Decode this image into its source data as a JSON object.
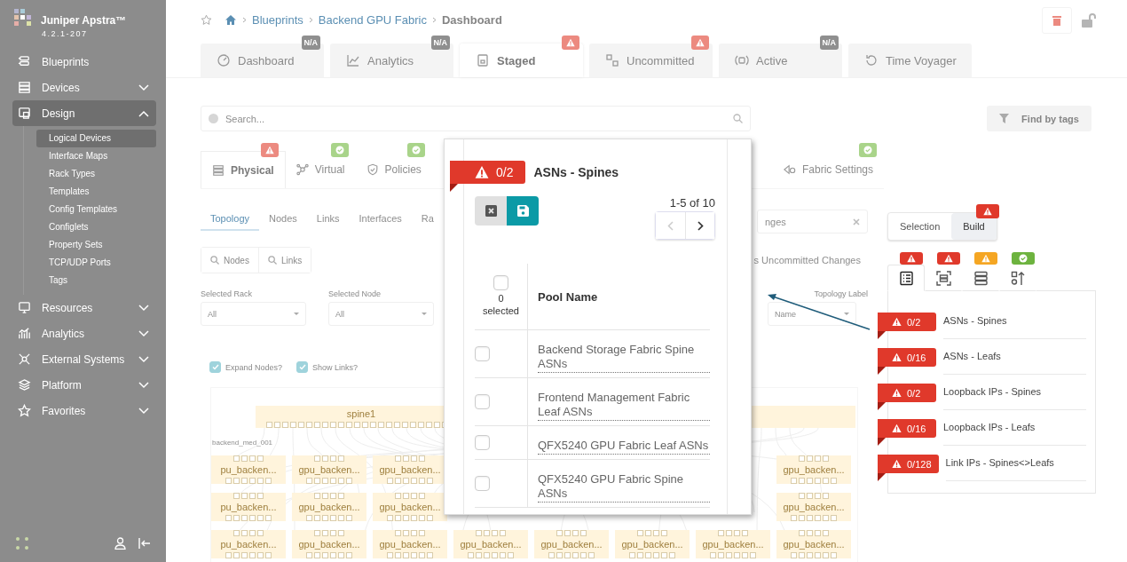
{
  "sidebar": {
    "product": "Juniper Apstra™",
    "version": "4.2.1-207",
    "items": [
      {
        "label": "Blueprints",
        "kind": "link"
      },
      {
        "label": "Devices",
        "kind": "group",
        "expanded": false
      },
      {
        "label": "Design",
        "kind": "group",
        "expanded": true,
        "children": [
          {
            "label": "Logical Devices",
            "selected": true
          },
          {
            "label": "Interface Maps",
            "selected": false
          },
          {
            "label": "Rack Types",
            "selected": false
          },
          {
            "label": "Templates",
            "selected": false
          },
          {
            "label": "Config Templates",
            "selected": false
          },
          {
            "label": "Configlets",
            "selected": false
          },
          {
            "label": "Property Sets",
            "selected": false
          },
          {
            "label": "TCP/UDP Ports",
            "selected": false
          },
          {
            "label": "Tags",
            "selected": false
          }
        ]
      },
      {
        "label": "Resources",
        "kind": "group",
        "expanded": false
      },
      {
        "label": "Analytics",
        "kind": "group",
        "expanded": false
      },
      {
        "label": "External Systems",
        "kind": "group",
        "expanded": false
      },
      {
        "label": "Platform",
        "kind": "group",
        "expanded": false
      },
      {
        "label": "Favorites",
        "kind": "group",
        "expanded": false
      }
    ]
  },
  "header": {
    "breadcrumbs": [
      "Blueprints",
      "Backend GPU Fabric",
      "Dashboard"
    ],
    "tabs": [
      {
        "label": "Dashboard",
        "selected": false,
        "badge": {
          "kind": "na",
          "text": "N/A"
        }
      },
      {
        "label": "Analytics",
        "selected": false,
        "badge": {
          "kind": "na",
          "text": "N/A"
        }
      },
      {
        "label": "Staged",
        "selected": true,
        "badge": {
          "kind": "warning"
        }
      },
      {
        "label": "Uncommitted",
        "selected": false,
        "badge": {
          "kind": "warning"
        }
      },
      {
        "label": "Active",
        "selected": false,
        "badge": {
          "kind": "na",
          "text": "N/A"
        }
      },
      {
        "label": "Time Voyager",
        "selected": false
      }
    ]
  },
  "search": {
    "placeholder": "Search..."
  },
  "find_button": "Find by tags",
  "sections": [
    {
      "label": "Physical",
      "selected": true,
      "badge": {
        "kind": "warning"
      }
    },
    {
      "label": "Virtual",
      "selected": false,
      "badge": {
        "kind": "ok"
      }
    },
    {
      "label": "Policies",
      "selected": false,
      "badge": {
        "kind": "ok"
      }
    },
    {
      "label": "Fabric Settings",
      "selected": false,
      "badge": {
        "kind": "ok"
      }
    }
  ],
  "view_tabs": [
    {
      "label": "Topology",
      "selected": true
    },
    {
      "label": "Nodes",
      "selected": false
    },
    {
      "label": "Links",
      "selected": false
    },
    {
      "label": "Interfaces",
      "selected": false
    },
    {
      "label": "Ra",
      "selected": false
    }
  ],
  "filter_field": {
    "placeholder": "nges"
  },
  "uncommitted_label": "s Uncommitted Changes",
  "query_buttons": [
    "Nodes",
    "Links"
  ],
  "selects": [
    {
      "label": "Selected Rack",
      "value": "All"
    },
    {
      "label": "Selected Node",
      "value": "All"
    },
    {
      "label": "Topology Label",
      "value": "Name"
    }
  ],
  "options": [
    {
      "label": "Expand Nodes?",
      "checked": true
    },
    {
      "label": "Show Links?",
      "checked": true
    }
  ],
  "topology": {
    "spine": "spine1",
    "rack": "backend_med_001",
    "rows": [
      [
        "pu_backen...",
        "gpu_backen...",
        "gpu_backen...",
        "gpu_backen..."
      ],
      [
        "pu_backen...",
        "gpu_backen...",
        "gpu_backen...",
        "gpu_backen..."
      ],
      [
        "pu_backen...",
        "gpu_backen...",
        "gpu_backen...",
        "gpu_backen...",
        "gpu_backen...",
        "gpu_backen...",
        "gpu_backen...",
        "gpu_backen..."
      ]
    ]
  },
  "right_panel": {
    "modes": [
      {
        "label": "Selection",
        "selected": false
      },
      {
        "label": "Build",
        "selected": true,
        "badge": {
          "kind": "warning"
        }
      }
    ],
    "icon_tabs": [
      {
        "selected": true,
        "badge": {
          "kind": "warning"
        }
      },
      {
        "selected": false,
        "badge": {
          "kind": "warning"
        }
      },
      {
        "selected": false,
        "badge": {
          "kind": "caution"
        }
      },
      {
        "selected": false,
        "badge": {
          "kind": "ok"
        }
      }
    ],
    "items": [
      {
        "count": "0/2",
        "label": "ASNs - Spines"
      },
      {
        "count": "0/16",
        "label": "ASNs - Leafs"
      },
      {
        "count": "0/2",
        "label": "Loopback IPs - Spines"
      },
      {
        "count": "0/16",
        "label": "Loopback IPs - Leafs"
      },
      {
        "count": "0/128",
        "label": "Link IPs - Spines<>Leafs"
      }
    ]
  },
  "popup": {
    "count": "0/2",
    "title": "ASNs - Spines",
    "range": "1-5 of 10",
    "prev_disabled": true,
    "header_checked": false,
    "selected_count": "0",
    "selected_label": "selected",
    "column": "Pool Name",
    "rows": [
      {
        "name": "Backend Storage Fabric Spine ASNs",
        "checked": false
      },
      {
        "name": "Frontend Management Fabric Leaf ASNs",
        "checked": false
      },
      {
        "name": "QFX5240 GPU Fabric Leaf ASNs",
        "checked": false
      },
      {
        "name": "QFX5240 GPU Fabric Spine ASNs",
        "checked": false
      }
    ]
  }
}
